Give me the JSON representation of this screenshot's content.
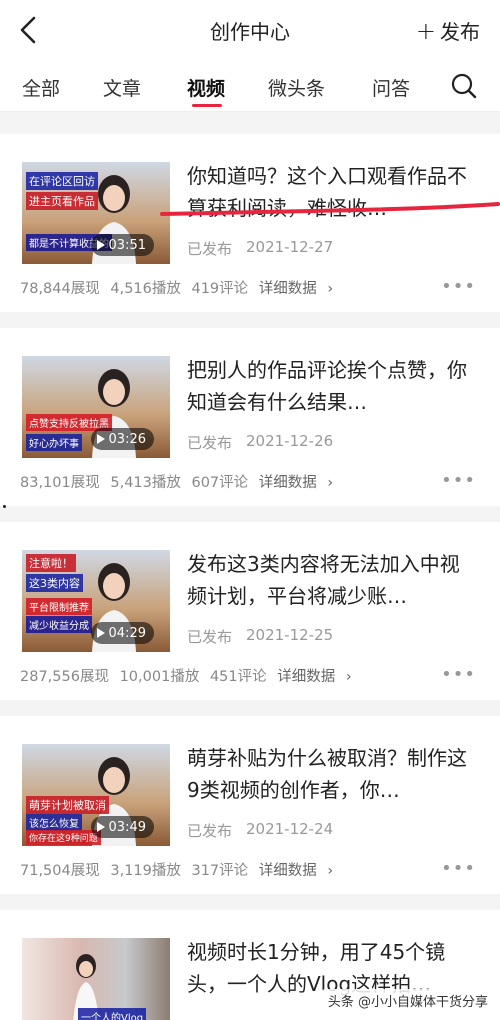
{
  "header": {
    "title": "创作中心",
    "publish_label": "发布"
  },
  "tabs": [
    {
      "label": "全部"
    },
    {
      "label": "文章"
    },
    {
      "label": "视频",
      "active": true
    },
    {
      "label": "微头条"
    },
    {
      "label": "问答"
    }
  ],
  "articles": [
    {
      "title": "你知道吗？这个入口观看作品不算获利阅读，难怪收…",
      "thumb_texts": [
        "在评论区回访",
        "进主页看作品",
        "都是不计算收益的"
      ],
      "duration": "03:51",
      "status": "已发布",
      "date": "2021-12-27",
      "views": "78,844展现",
      "plays": "4,516播放",
      "comments": "419评论",
      "details_label": "详细数据"
    },
    {
      "title": "把别人的作品评论挨个点赞，你知道会有什么结果…",
      "thumb_texts": [
        "点赞支持反被拉黑",
        "好心办坏事"
      ],
      "duration": "03:26",
      "status": "已发布",
      "date": "2021-12-26",
      "views": "83,101展现",
      "plays": "5,413播放",
      "comments": "607评论",
      "details_label": "详细数据"
    },
    {
      "title": "发布这3类内容将无法加入中视频计划，平台将减少账…",
      "thumb_texts": [
        "注意啦！",
        "这3类内容",
        "平台限制推荐",
        "减少收益分成"
      ],
      "duration": "04:29",
      "status": "已发布",
      "date": "2021-12-25",
      "views": "287,556展现",
      "plays": "10,001播放",
      "comments": "451评论",
      "details_label": "详细数据"
    },
    {
      "title": "萌芽补贴为什么被取消？制作这9类视频的创作者，你…",
      "thumb_texts": [
        "萌芽计划被取消",
        "该怎么恢复",
        "你存在这9种问题"
      ],
      "duration": "03:49",
      "status": "已发布",
      "date": "2021-12-24",
      "views": "71,504展现",
      "plays": "3,119播放",
      "comments": "317评论",
      "details_label": "详细数据"
    },
    {
      "title": "视频时长1分钟，用了45个镜头，一个人的Vlog这样拍…",
      "thumb_texts": [
        "一个人的Vlog"
      ]
    }
  ],
  "watermark": "头条 @小小自媒体干货分享",
  "colors": {
    "accent": "#e8253e"
  }
}
